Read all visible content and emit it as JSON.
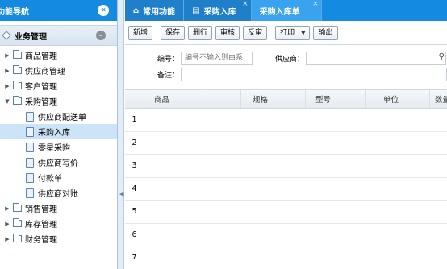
{
  "sidebar": {
    "title": "功能导航",
    "collapse_glyph": "«",
    "panel_title": "业务管理",
    "items": [
      {
        "label": "商品管理",
        "level": 1,
        "expanded": false
      },
      {
        "label": "供应商管理",
        "level": 1,
        "expanded": false
      },
      {
        "label": "客户管理",
        "level": 1,
        "expanded": false
      },
      {
        "label": "采购管理",
        "level": 1,
        "expanded": true
      },
      {
        "label": "供应商配送单",
        "level": 2
      },
      {
        "label": "采购入库",
        "level": 2,
        "selected": true
      },
      {
        "label": "零星采购",
        "level": 2
      },
      {
        "label": "供应商写价",
        "level": 2
      },
      {
        "label": "付款单",
        "level": 2
      },
      {
        "label": "供应商对账",
        "level": 2
      },
      {
        "label": "销售管理",
        "level": 1,
        "expanded": false
      },
      {
        "label": "库存管理",
        "level": 1,
        "expanded": false
      },
      {
        "label": "财务管理",
        "level": 1,
        "expanded": false
      }
    ]
  },
  "tabs": [
    {
      "label": "常用功能",
      "icon": "home-icon",
      "closable": false,
      "active": false
    },
    {
      "label": "采购入库",
      "icon": "list-icon",
      "closable": true,
      "active": false
    },
    {
      "label": "采购入库单",
      "icon": "",
      "closable": true,
      "active": true
    }
  ],
  "toolbar": {
    "new": "新增",
    "save": "保存",
    "delete_row": "删行",
    "audit": "审核",
    "unaudit": "反审",
    "print": "打印",
    "export": "输出"
  },
  "form": {
    "code_label": "编号：",
    "code_placeholder": "编号不输入则由系",
    "supplier_label": "供应商：",
    "supplier_value": "",
    "remark_label": "备注：",
    "remark_value": ""
  },
  "grid": {
    "columns": [
      "商品",
      "规格",
      "型号",
      "单位",
      "数量"
    ],
    "rows": [
      "1",
      "2",
      "3",
      "4",
      "5",
      "6",
      "7"
    ]
  },
  "colors": {
    "header_blue": "#148be0",
    "active_tab": "#3aa3f0",
    "selected_item": "#cde3f7"
  }
}
